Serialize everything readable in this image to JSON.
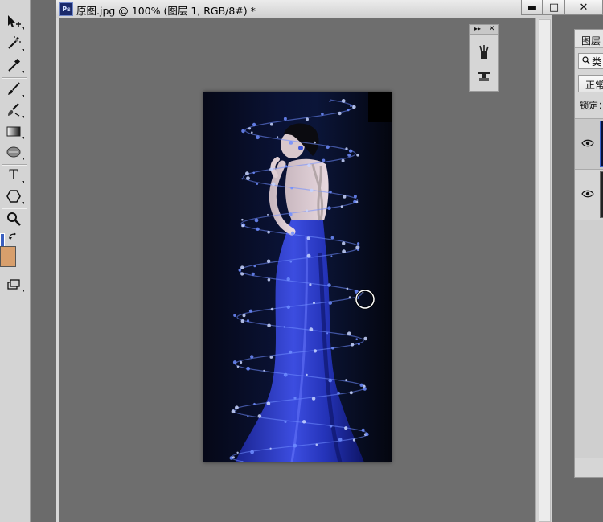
{
  "document": {
    "app_badge": "Ps",
    "title": "原图.jpg @ 100% (图层 1, RGB/8#) *",
    "buttons": {
      "minimize": "▬",
      "maximize": "□",
      "close": "✕"
    }
  },
  "tools": [
    "move-tool-icon",
    "magic-wand-icon",
    "eyedropper-icon",
    "brush-icon",
    "clone-stamp-icon",
    "gradient-icon",
    "blur-icon",
    "type-icon",
    "shape-icon",
    "zoom-icon",
    "swap-colors-icon",
    "screen-mode-icon"
  ],
  "tool_labels": {
    "type": "T"
  },
  "colors": {
    "foreground": "#3b5fbf",
    "background": "#d89f6c",
    "canvas_bg": "#6b6b6b",
    "sparkle": "#6f8dff"
  },
  "mini_panel": {
    "collapse": "▸▸",
    "close": "✕",
    "icons": [
      "brush-presets-icon",
      "clone-source-icon"
    ]
  },
  "layers_panel": {
    "tab_label": "图层",
    "search_label": "类",
    "blend_mode": "正常",
    "lock_label": "锁定：",
    "rows": [
      {
        "name": "layer-1",
        "visible": true,
        "selected": true
      },
      {
        "name": "background-layer",
        "visible": true,
        "selected": false
      }
    ]
  }
}
